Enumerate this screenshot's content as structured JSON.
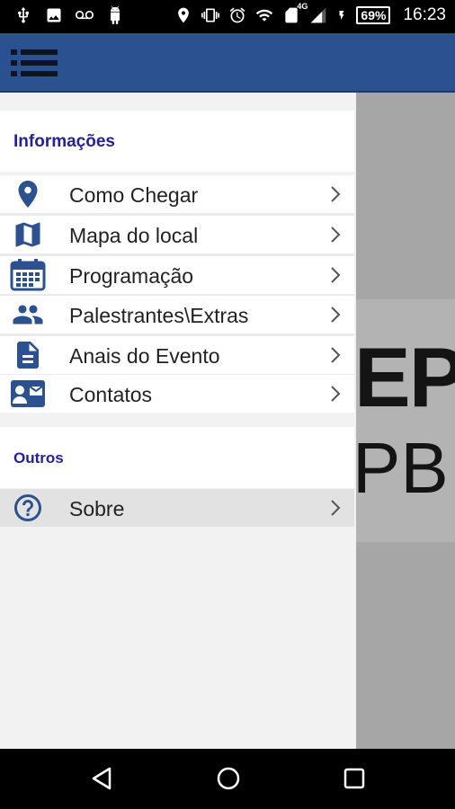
{
  "status_bar": {
    "left_icons": [
      "usb-icon",
      "image-icon",
      "voicemail-icon",
      "android-debug-icon"
    ],
    "right_icons": [
      "location-icon",
      "vibrate-icon",
      "alarm-icon",
      "wifi-icon",
      "sim-icon",
      "signal-icon",
      "charging-icon"
    ],
    "network_label": "4G",
    "battery": "69%",
    "time": "16:23"
  },
  "app_bar": {
    "color": "#2b5190",
    "menu_icon": "menu-icon"
  },
  "background_screen": {
    "line1": "EP",
    "line2": "PB"
  },
  "drawer": {
    "sections": [
      {
        "title": "Informações",
        "items": [
          {
            "label": "Como Chegar",
            "icon": "location-pin-icon"
          },
          {
            "label": "Mapa do local",
            "icon": "map-icon"
          },
          {
            "label": "Programação",
            "icon": "calendar-icon"
          },
          {
            "label": "Palestrantes\\Extras",
            "icon": "people-icon"
          },
          {
            "label": "Anais do Evento",
            "icon": "document-icon"
          },
          {
            "label": "Contatos",
            "icon": "contact-card-icon"
          }
        ]
      },
      {
        "title": "Outros",
        "items": [
          {
            "label": "Sobre",
            "icon": "help-circle-icon",
            "selected": true
          }
        ]
      }
    ],
    "accent_color": "#24219a",
    "icon_color": "#2b5190"
  },
  "nav_bar": {
    "buttons": [
      "back-icon",
      "home-icon",
      "recents-icon"
    ]
  }
}
